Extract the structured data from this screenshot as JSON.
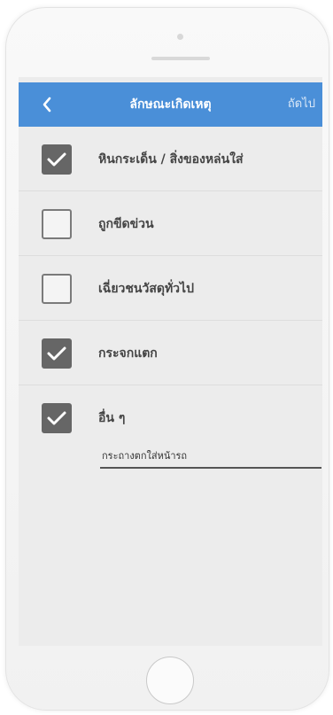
{
  "navbar": {
    "title": "ลักษณะเกิดเหตุ",
    "next_label": "ถัดไป",
    "color": "#4a8fd8"
  },
  "items": [
    {
      "label": "หินกระเด็น / สิ่งของหล่นใส่",
      "checked": true
    },
    {
      "label": "ถูกขีดข่วน",
      "checked": false
    },
    {
      "label": "เฉี่ยวชนวัสดุทั่วไป",
      "checked": false
    },
    {
      "label": "กระจกแตก",
      "checked": true
    },
    {
      "label": "อื่น ๆ",
      "checked": true
    }
  ],
  "other_input": {
    "value": "กระถางตกใส่หน้ารถ"
  }
}
